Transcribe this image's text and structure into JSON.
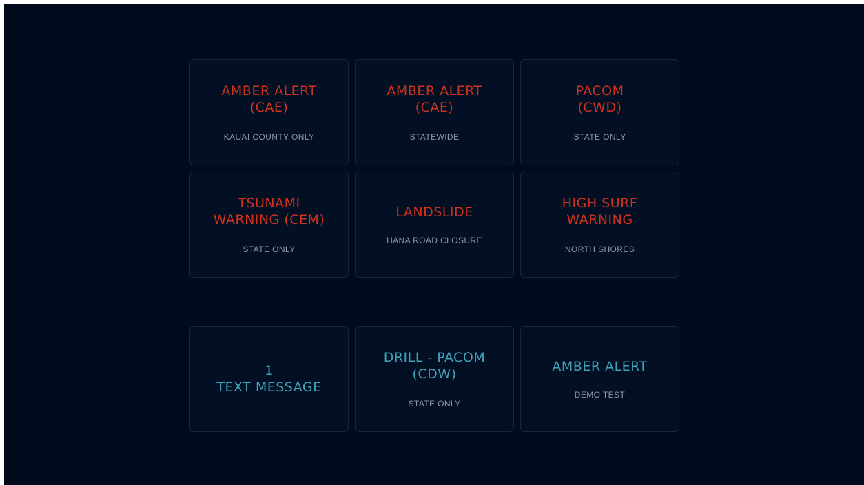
{
  "alert_tiles": [
    {
      "title": "AMBER ALERT\n(CAE)",
      "subtitle": "KAUAI COUNTY ONLY"
    },
    {
      "title": "AMBER ALERT\n(CAE)",
      "subtitle": "STATEWIDE"
    },
    {
      "title": "PACOM\n(CWD)",
      "subtitle": "STATE ONLY"
    },
    {
      "title": "TSUNAMI\nWARNING (CEM)",
      "subtitle": "STATE ONLY"
    },
    {
      "title": "LANDSLIDE",
      "subtitle": "HANA ROAD CLOSURE"
    },
    {
      "title": "HIGH SURF\nWARNING",
      "subtitle": "NORTH SHORES"
    }
  ],
  "test_tiles": [
    {
      "title": "1\nTEXT MESSAGE"
    },
    {
      "title": "DRILL - PACOM\n(CDW)",
      "subtitle": "STATE ONLY"
    },
    {
      "title": "AMBER ALERT",
      "subtitle": "DEMO TEST"
    }
  ],
  "colors": {
    "background": "#020b1d",
    "tile_border": "#15263d",
    "alert_title": "#d2321c",
    "test_title": "#3fa3b8",
    "subtitle": "#8e97a6"
  }
}
